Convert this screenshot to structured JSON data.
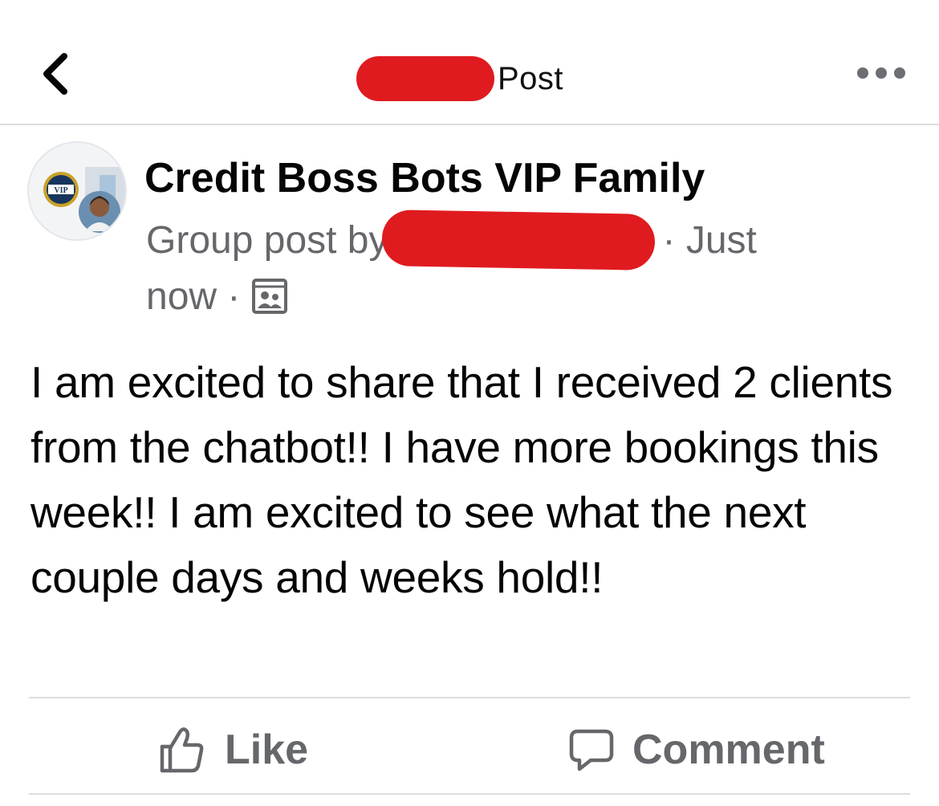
{
  "header": {
    "title": "Post",
    "back_icon": "chevron-left-icon",
    "more_icon": "more-horizontal-icon"
  },
  "post": {
    "group_name": "Credit Boss Bots VIP Family",
    "group_post_by": "Group post by",
    "time_prefix": "· Just",
    "time_suffix": "now ·",
    "audience_icon": "group-audience-icon",
    "body": "I am excited to share that I received 2 clients from the chatbot!! I have more bookings this week!! I am excited to see what the next couple days and weeks hold!!"
  },
  "actions": {
    "like_label": "Like",
    "comment_label": "Comment"
  },
  "colors": {
    "redaction": "#e01b1f",
    "secondary_text": "#65676b",
    "primary_text": "#050505",
    "divider": "#dadde1"
  }
}
